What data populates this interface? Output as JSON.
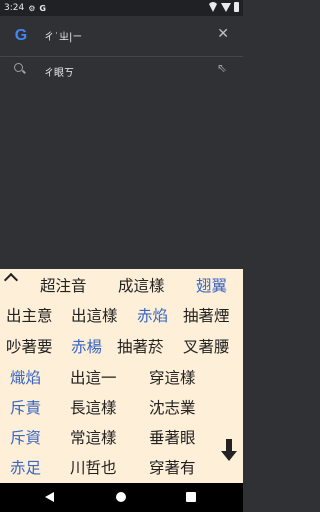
{
  "status": {
    "time": "3:24",
    "icons": [
      "gear-icon",
      "google-g-icon",
      "wifi-icon",
      "signal-icon",
      "battery-icon"
    ]
  },
  "search": {
    "query": "ㄔ˙ㄓ|ㄧ",
    "logo": "G"
  },
  "suggestion": {
    "text": "ㄔ眼ㄎ"
  },
  "keyboard": {
    "row1": [
      "超注音",
      "成這樣",
      "翅翼"
    ],
    "row2": [
      "出主意",
      "出這樣",
      "赤焰",
      "抽著煙"
    ],
    "row3": [
      "吵著要",
      "赤楊",
      "抽著菸",
      "叉著腰"
    ],
    "row4": [
      "熾焰",
      "出這一",
      "穿這樣"
    ],
    "row5": [
      "斥責",
      "長這樣",
      "沈志業"
    ],
    "row6": [
      "斥資",
      "常這樣",
      "垂著眼"
    ],
    "row7": [
      "赤足",
      "川哲也",
      "穿著有"
    ]
  },
  "colors": {
    "blue": "#3a66c4",
    "keyboard_bg": "#fdefd8"
  }
}
